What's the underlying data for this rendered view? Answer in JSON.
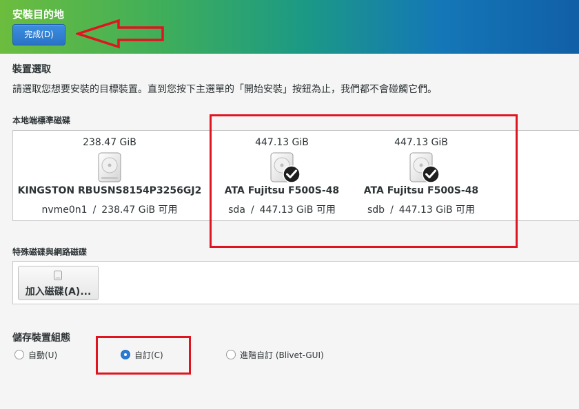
{
  "header": {
    "title": "安裝目的地",
    "done_button": "完成(D)"
  },
  "device_selection": {
    "title": "裝置選取",
    "instruction": "請選取您想要安裝的目標裝置。直到您按下主選單的「開始安裝」按鈕為止，我們都不會碰觸它們。"
  },
  "local_disks": {
    "label": "本地端標準磁碟",
    "disks": [
      {
        "size": "238.47 GiB",
        "name": "KINGSTON RBUSNS8154P3256GJ2",
        "device": "nvme0n1",
        "free": "238.47 GiB 可用",
        "selected": false
      },
      {
        "size": "447.13 GiB",
        "name": "ATA Fujitsu F500S-48",
        "device": "sda",
        "free": "447.13 GiB 可用",
        "selected": true
      },
      {
        "size": "447.13 GiB",
        "name": "ATA Fujitsu F500S-48",
        "device": "sdb",
        "free": "447.13 GiB 可用",
        "selected": true
      }
    ],
    "separator": "/"
  },
  "special_disks": {
    "label": "特殊磁碟與網路磁碟",
    "add_button": "加入磁碟(A)..."
  },
  "storage_config": {
    "title": "儲存裝置組態",
    "options": [
      {
        "label": "自動(U)",
        "checked": false
      },
      {
        "label": "自訂(C)",
        "checked": true
      },
      {
        "label": "進階自訂 (Blivet-GUI)",
        "checked": false
      }
    ]
  },
  "annotation_color": "#e0141e"
}
